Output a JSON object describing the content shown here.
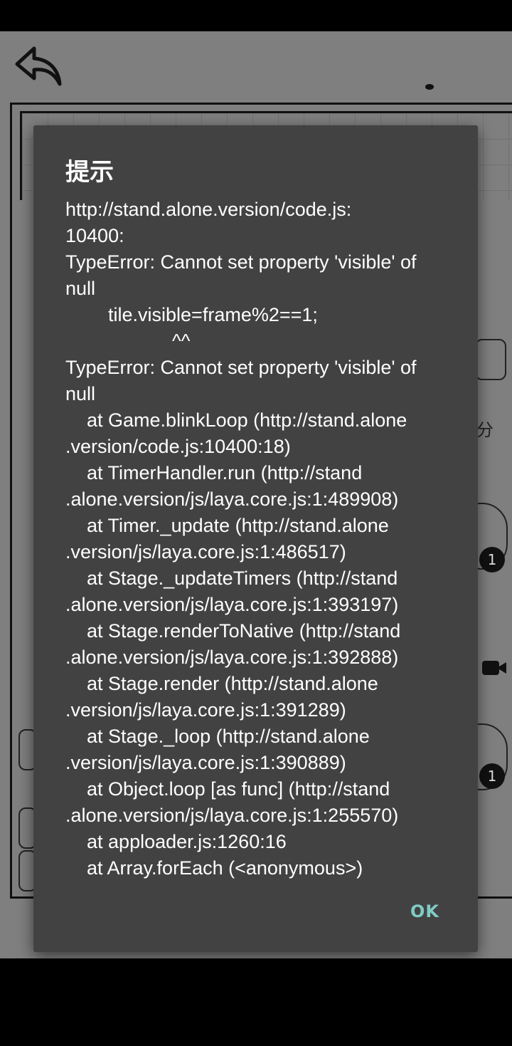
{
  "game": {
    "back_icon": "back-arrow-icon",
    "badges": [
      "1",
      "1"
    ],
    "side_labels": [
      "分"
    ]
  },
  "dialog": {
    "title": "提示",
    "message": "http://stand.alone.version/code.js:\n10400:\nTypeError: Cannot set property 'visible' of\nnull\n        tile.visible=frame%2==1;\n                    ^^\nTypeError: Cannot set property 'visible' of\nnull\n    at Game.blinkLoop (http://stand.alone\n.version/code.js:10400:18)\n    at TimerHandler.run (http://stand\n.alone.version/js/laya.core.js:1:489908)\n    at Timer._update (http://stand.alone\n.version/js/laya.core.js:1:486517)\n    at Stage._updateTimers (http://stand\n.alone.version/js/laya.core.js:1:393197)\n    at Stage.renderToNative (http://stand\n.alone.version/js/laya.core.js:1:392888)\n    at Stage.render (http://stand.alone\n.version/js/laya.core.js:1:391289)\n    at Stage._loop (http://stand.alone\n.version/js/laya.core.js:1:390889)\n    at Object.loop [as func] (http://stand\n.alone.version/js/laya.core.js:1:255570)\n    at apploader.js:1260:16\n    at Array.forEach (<anonymous>)",
    "ok_label": "OK",
    "accent_color": "#80cbc4",
    "background_color": "#424242"
  }
}
